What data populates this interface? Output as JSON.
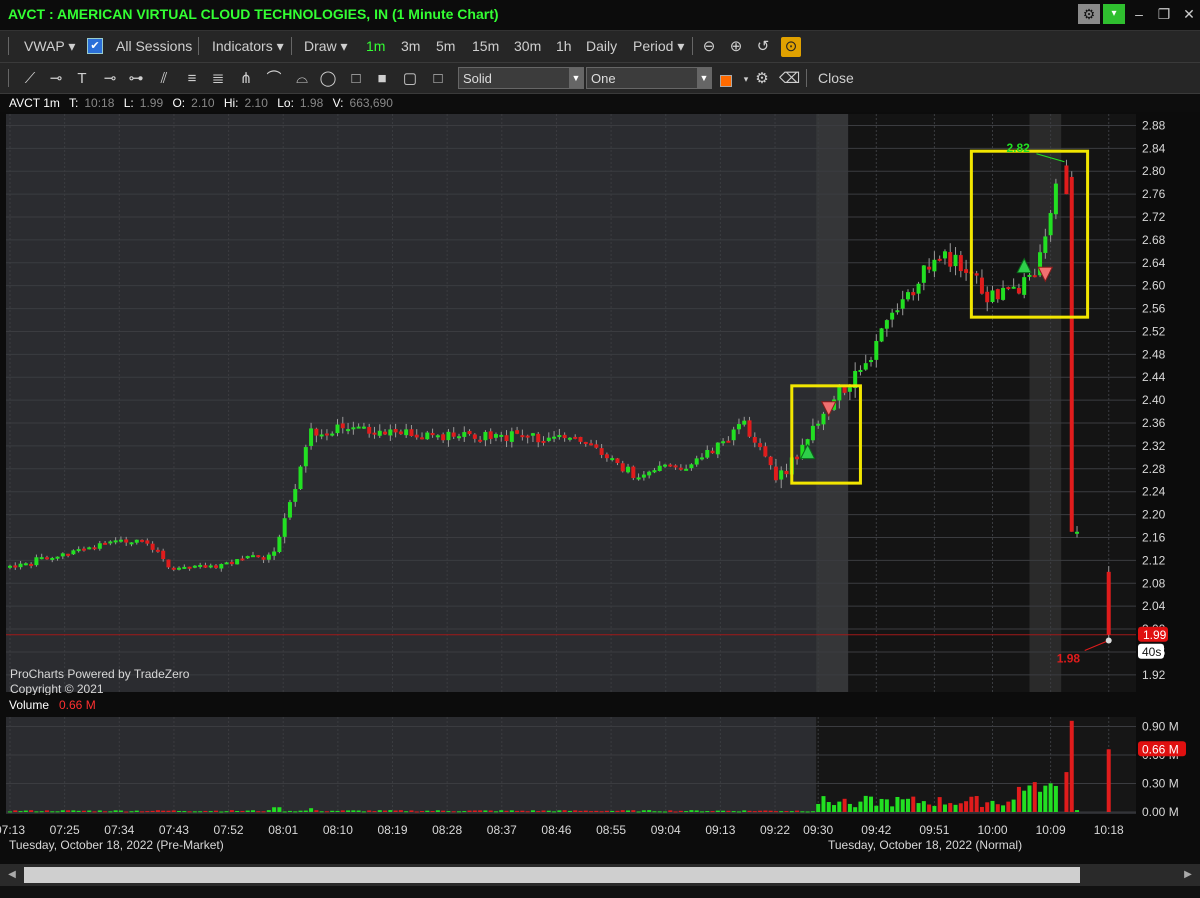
{
  "window": {
    "title": "AVCT : AMERICAN VIRTUAL CLOUD TECHNOLOGIES, IN (1 Minute Chart)",
    "btn_min": "–",
    "btn_max": "❐",
    "btn_close": "✕"
  },
  "toolbar1": {
    "vwap": "VWAP ▾",
    "all_sessions": "All Sessions",
    "indicators": "Indicators ▾",
    "draw": "Draw ▾",
    "intervals": [
      "1m",
      "3m",
      "5m",
      "15m",
      "30m",
      "1h",
      "Daily"
    ],
    "active_interval": "1m",
    "period": "Period ▾"
  },
  "toolbar2": {
    "line_style": "Solid",
    "line_width": "One",
    "close": "Close"
  },
  "infobar": {
    "symbol": "AVCT 1m",
    "t_label": "T:",
    "t_value": "10:18",
    "l_label": "L:",
    "l_value": "1.99",
    "o_label": "O:",
    "o_value": "2.10",
    "h_label": "Hi:",
    "h_value": "2.10",
    "lo_label": "Lo:",
    "lo_value": "1.98",
    "v_label": "V:",
    "v_value": "663,690"
  },
  "watermark": {
    "line1": "ProCharts Powered by TradeZero",
    "line2": "Copyright © 2021"
  },
  "chart_data": {
    "type": "candlestick",
    "symbol": "AVCT",
    "interval": "1 Minute",
    "price_axis": {
      "ticks": [
        1.92,
        1.96,
        2.0,
        2.04,
        2.08,
        2.12,
        2.16,
        2.2,
        2.24,
        2.28,
        2.32,
        2.36,
        2.4,
        2.44,
        2.48,
        2.52,
        2.56,
        2.6,
        2.64,
        2.68,
        2.72,
        2.76,
        2.8,
        2.84,
        2.88
      ],
      "range": [
        1.89,
        2.9
      ]
    },
    "time_axis": {
      "ticks": [
        "07:13",
        "07:25",
        "07:34",
        "07:43",
        "07:52",
        "08:01",
        "08:10",
        "08:19",
        "08:28",
        "08:37",
        "08:46",
        "08:55",
        "09:04",
        "09:13",
        "09:22",
        "09:30",
        "09:42",
        "09:51",
        "10:00",
        "10:09",
        "10:18"
      ],
      "session_labels": [
        "Tuesday, October 18, 2022 (Pre-Market)",
        "Tuesday, October 18, 2022 (Normal)"
      ]
    },
    "current_price": "1.99",
    "countdown": "40s",
    "high_annotation": "2.82",
    "low_annotation": "1.98",
    "volume_panel": {
      "label": "Volume",
      "value": "0.66 M",
      "ticks": [
        "0.90 M",
        "0.60 M",
        "0.30 M",
        "0.00 M"
      ],
      "current_tag": "0.66 M",
      "range": [
        0,
        1.0
      ]
    },
    "phases": [
      {
        "t0": 0,
        "p0": 2.11,
        "t1": 25,
        "p1": 2.16,
        "noise": 0.006,
        "seed": 1
      },
      {
        "t0": 25,
        "p0": 2.16,
        "t1": 31,
        "p1": 2.1,
        "noise": 0.006,
        "seed": 2
      },
      {
        "t0": 31,
        "p0": 2.1,
        "t1": 50,
        "p1": 2.13,
        "noise": 0.006,
        "seed": 3
      },
      {
        "t0": 50,
        "p0": 2.13,
        "t1": 57,
        "p1": 2.35,
        "noise": 0.012,
        "seed": 4
      },
      {
        "t0": 57,
        "p0": 2.35,
        "t1": 108,
        "p1": 2.33,
        "noise": 0.012,
        "seed": 5
      },
      {
        "t0": 108,
        "p0": 2.33,
        "t1": 118,
        "p1": 2.27,
        "noise": 0.008,
        "seed": 6
      },
      {
        "t0": 118,
        "p0": 2.27,
        "t1": 130,
        "p1": 2.29,
        "noise": 0.008,
        "seed": 7
      },
      {
        "t0": 130,
        "p0": 2.29,
        "t1": 139,
        "p1": 2.36,
        "noise": 0.01,
        "seed": 8
      },
      {
        "t0": 139,
        "p0": 2.36,
        "t1": 145,
        "p1": 2.26,
        "noise": 0.01,
        "seed": 9
      },
      {
        "t0": 145,
        "p0": 2.26,
        "t1": 158,
        "p1": 2.42,
        "noise": 0.015,
        "seed": 10
      },
      {
        "t0": 158,
        "p0": 2.42,
        "t1": 176,
        "p1": 2.66,
        "noise": 0.018,
        "seed": 11
      },
      {
        "t0": 176,
        "p0": 2.66,
        "t1": 186,
        "p1": 2.58,
        "noise": 0.018,
        "seed": 12
      },
      {
        "t0": 186,
        "p0": 2.58,
        "t1": 194,
        "p1": 2.61,
        "noise": 0.015,
        "seed": 13
      },
      {
        "t0": 194,
        "p0": 2.61,
        "t1": 199,
        "p1": 2.81,
        "noise": 0.015,
        "seed": 14
      }
    ],
    "special_bars": [
      {
        "t": 200,
        "o": 2.81,
        "h": 2.82,
        "l": 2.76,
        "c": 2.76
      },
      {
        "t": 201,
        "o": 2.79,
        "h": 2.8,
        "l": 2.17,
        "c": 2.17
      },
      {
        "t": 202,
        "o": 2.17,
        "h": 2.18,
        "l": 2.16,
        "c": 2.17
      },
      {
        "t": 208,
        "o": 2.1,
        "h": 2.11,
        "l": 1.98,
        "c": 1.99
      }
    ],
    "markers": [
      {
        "type": "buy",
        "t": 151,
        "price": 2.31
      },
      {
        "type": "sell",
        "t": 155,
        "price": 2.385
      },
      {
        "type": "buy",
        "t": 192,
        "price": 2.635
      },
      {
        "type": "sell",
        "t": 196,
        "price": 2.62
      }
    ],
    "highlight_boxes": [
      {
        "t0": 148,
        "t1": 161,
        "p_low": 2.255,
        "p_high": 2.425
      },
      {
        "t0": 182,
        "t1": 204,
        "p_low": 2.545,
        "p_high": 2.835
      }
    ],
    "session_boundary_t": 153,
    "total_bars": 210
  }
}
